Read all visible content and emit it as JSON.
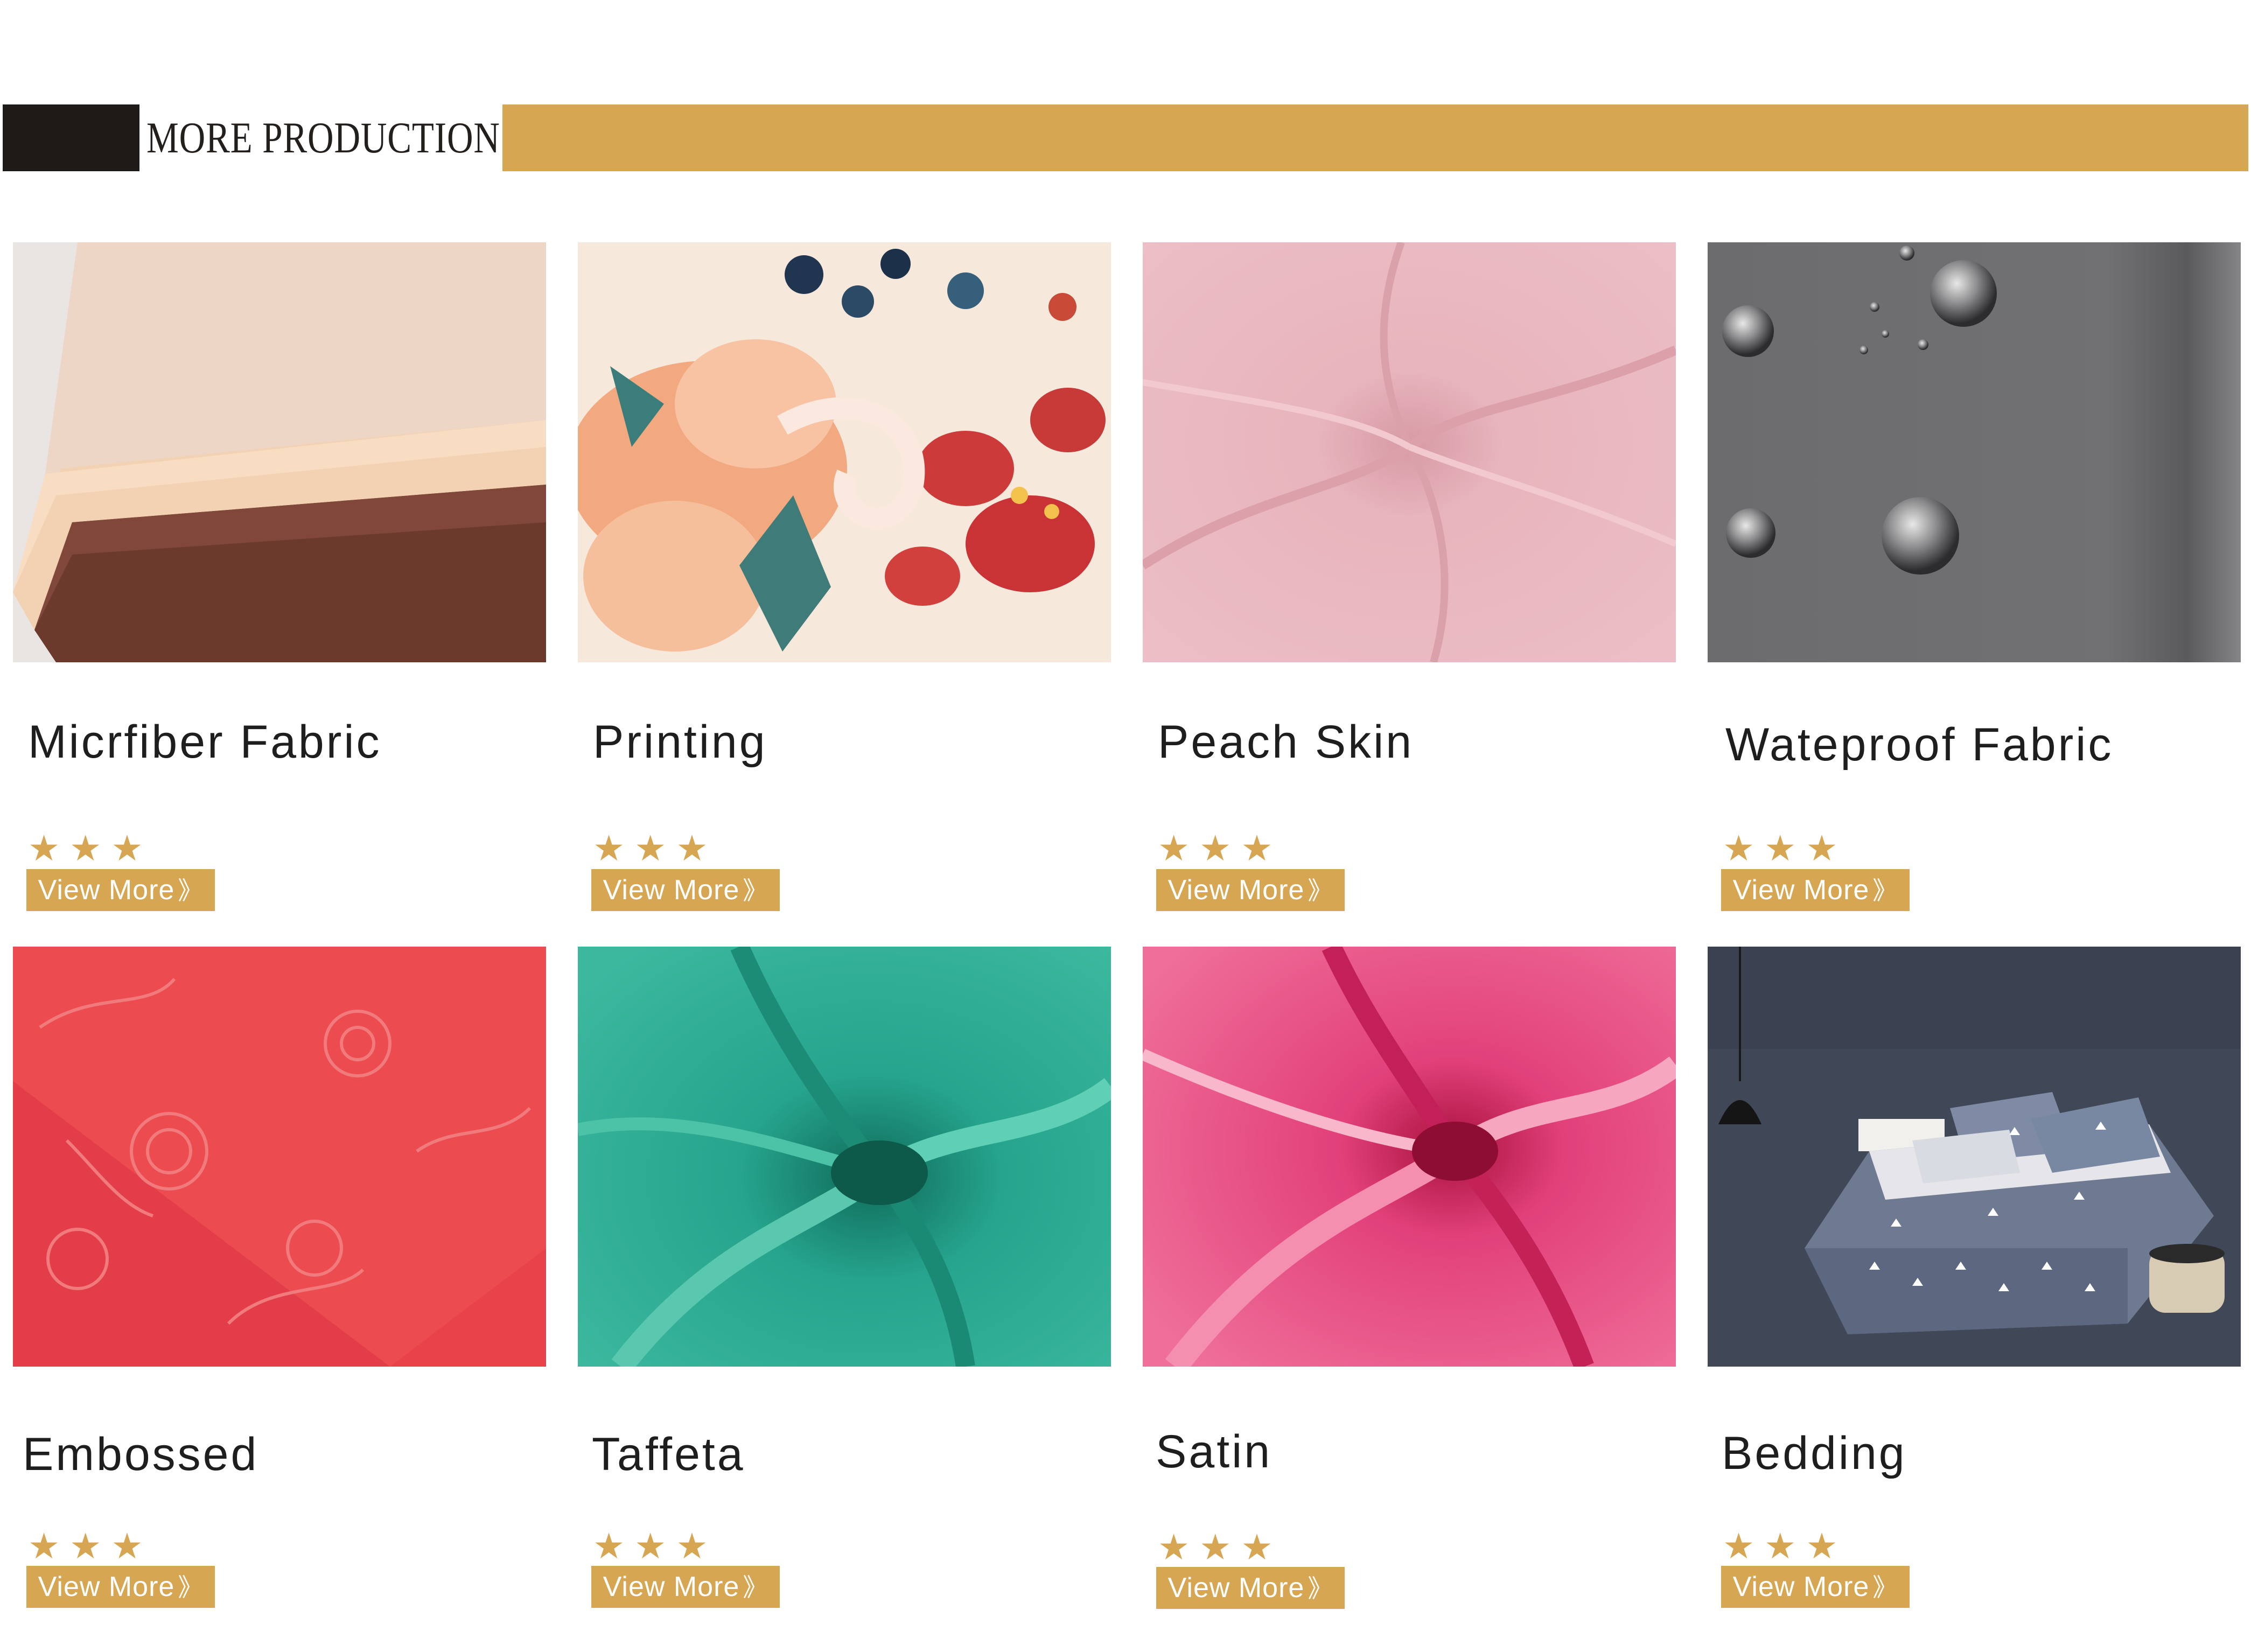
{
  "section": {
    "title": "MORE PRODUCTION"
  },
  "products": [
    {
      "name": "Micrfiber Fabric",
      "stars": "★★★",
      "button": "View More",
      "chevron": "》"
    },
    {
      "name": "Printing",
      "stars": "★★★",
      "button": "View More",
      "chevron": "》"
    },
    {
      "name": "Peach Skin",
      "stars": "★★★",
      "button": "View More",
      "chevron": "》"
    },
    {
      "name": "Wateproof Fabric",
      "stars": "★★★",
      "button": "View More",
      "chevron": "》"
    },
    {
      "name": "Embossed",
      "stars": "★★★",
      "button": "View More",
      "chevron": "》"
    },
    {
      "name": "Taffeta",
      "stars": "★★★",
      "button": "View More",
      "chevron": "》"
    },
    {
      "name": "Satin",
      "stars": "★★★",
      "button": "View More",
      "chevron": "》"
    },
    {
      "name": "Bedding",
      "stars": "★★★",
      "button": "View More",
      "chevron": "》"
    }
  ],
  "colors": {
    "accent": "#d6a653",
    "header_dark": "#1e1a18",
    "text": "#1e1e1e"
  }
}
